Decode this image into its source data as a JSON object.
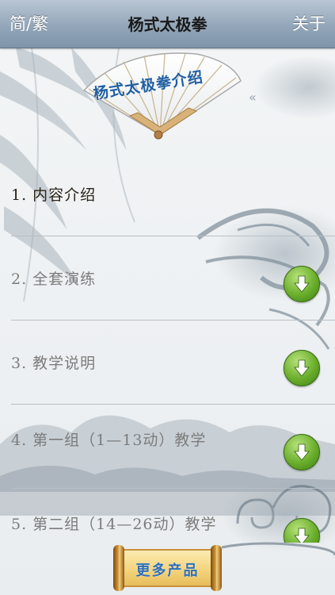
{
  "navbar": {
    "left_label": "简/繁",
    "title": "杨式太极拳",
    "right_label": "关于"
  },
  "banner": {
    "fan_text": "杨式太极拳介绍",
    "back_icon": "double-chevron-left-icon"
  },
  "list": {
    "items": [
      {
        "label": "1. 内容介绍",
        "download": false,
        "active": true
      },
      {
        "label": "2. 全套演练",
        "download": true,
        "active": false
      },
      {
        "label": "3. 教学说明",
        "download": true,
        "active": false
      },
      {
        "label": "4. 第一组（1—13动）教学",
        "download": true,
        "active": false
      },
      {
        "label": "5. 第二组（14—26动）教学",
        "download": true,
        "active": false
      }
    ],
    "download_icon": "arrow-down-icon"
  },
  "footer": {
    "more_products_label": "更多产品"
  },
  "colors": {
    "navbar": "#93a6b9",
    "download_green": "#6aae2c",
    "fan_text_blue": "#1f5fa3",
    "scroll_gold": "#f3d27a"
  }
}
